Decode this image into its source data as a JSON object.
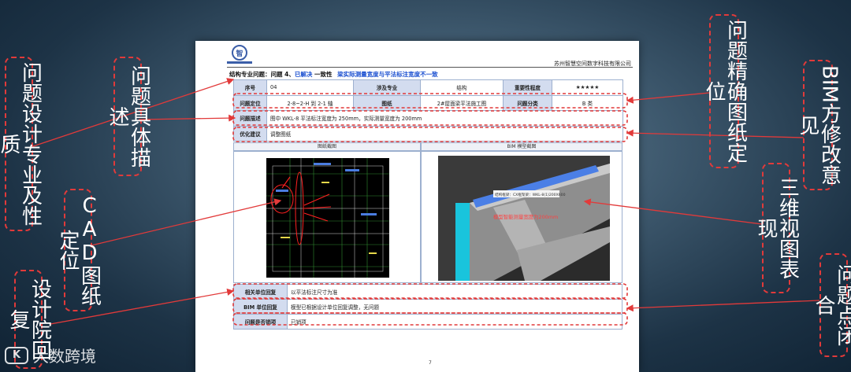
{
  "sheet": {
    "company": "苏州智慧空间数字科技有限公司",
    "logo_text": "智",
    "issue_prefix": "结构专业问题：问题 4、",
    "issue_status": "已解决",
    "issue_kind": "一致性",
    "issue_desc": "梁实际测量宽度与平法标注宽度不一致",
    "rows": {
      "seq_label": "序号",
      "seq_value": "04",
      "major_label": "涉及专业",
      "major_value": "结构",
      "importance_label": "重要性程度",
      "importance_value": "★★★★★",
      "loc_label": "问题定位",
      "loc_value": "2-8~2-H 到 2-1 轴",
      "drawing_label": "图纸",
      "drawing_value": "2#屋面梁平法施工图",
      "category_label": "问题分类",
      "category_value": "B 类",
      "desc_label": "问题描述",
      "desc_value": "图中 WKL-8 平法标注宽度为 250mm，实际测量宽度为 200mm",
      "advice_label": "优化建议",
      "advice_value": "调整图纸"
    },
    "img_headers": {
      "cad": "图纸截图",
      "bim": "BIM 模型截图"
    },
    "bim_tag": "结构框梁：CX框架梁：WKL-8(1)200X600",
    "bim_note": "模型智能测量宽度为200mm",
    "reply": {
      "unit_label": "相关单位回复",
      "unit_value": "以平法标注尺寸为准",
      "bim_label": "BIM 单位回复",
      "bim_value": "模型已根据设计单位回复调整，无问题",
      "closed_label": "问题是否销项",
      "closed_value": "已销项"
    },
    "page_number": "7"
  },
  "callouts": {
    "design_major": "问题设计专业及性质",
    "specific_desc": "问题具体描述",
    "cad_locate": "CAD图纸定位",
    "design_reply": "设计院回复",
    "precise_locate": "问题精确图纸定位",
    "bim_advice": "BIM方修改意见",
    "view_3d": "三维视图表现",
    "closure": "问题点闭合"
  },
  "watermark": {
    "icon_text": "K",
    "text": "大数跨境"
  },
  "colors": {
    "callout_border": "#e23a3a",
    "title_blue": "#1a4fd0",
    "table_header": "#d3dcef"
  }
}
